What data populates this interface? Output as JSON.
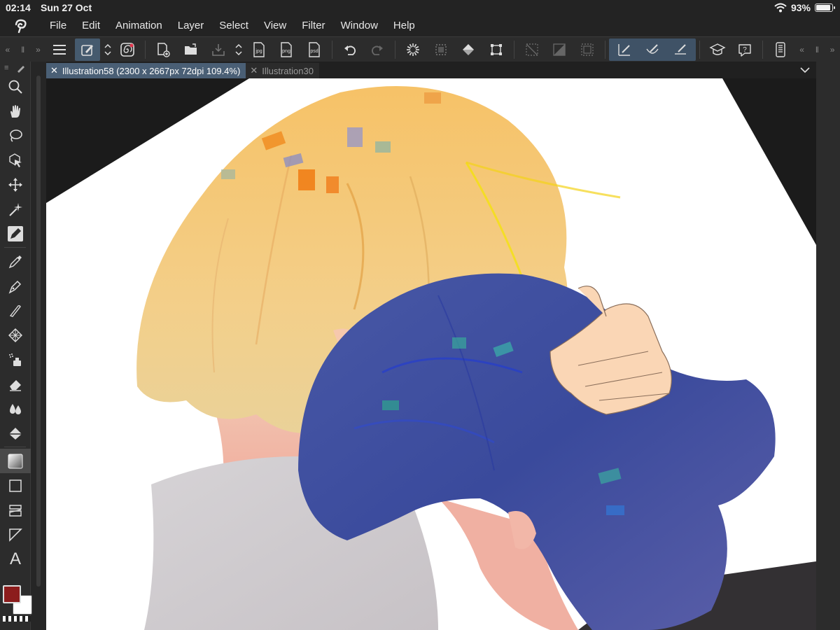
{
  "status": {
    "time": "02:14",
    "date": "Sun 27 Oct",
    "battery": "93%",
    "battery_level": 0.93
  },
  "menu": {
    "items": [
      "File",
      "Edit",
      "Animation",
      "Layer",
      "Select",
      "View",
      "Filter",
      "Window",
      "Help"
    ]
  },
  "command_bar": {
    "icons": [
      "menu-icon",
      "edit-brush-icon",
      "chevron-updown-icon",
      "spiral-icon",
      "new-canvas-icon",
      "open-folder-icon",
      "save-icon",
      "chevron-updown-icon",
      "jpg-export-icon",
      "png-export-icon",
      "psd-export-icon",
      "undo-icon",
      "redo-icon",
      "loading-icon",
      "select-dotted-icon",
      "fill-bucket-icon",
      "transform-icon",
      "deselect-icon",
      "invert-icon",
      "select-border-icon",
      "snap-ruler-icon",
      "snap-curve-icon",
      "snap-line-icon",
      "learn-icon",
      "help-icon",
      "tablet-icon"
    ],
    "labels": {
      "jpg": "jpg",
      "png": "png",
      "psd": "psd"
    }
  },
  "tools": [
    "search-zoom-icon",
    "hand-icon",
    "lasso-icon",
    "select-object-icon",
    "move-icon",
    "magic-wand-icon",
    "pen-fill-icon",
    "eyedropper-icon",
    "pen-icon",
    "pencil-icon",
    "pattern-icon",
    "airbrush-icon",
    "eraser-icon",
    "blend-icon",
    "fill-icon",
    "gradient-icon",
    "rectangle-icon",
    "frame-icon",
    "ruler-icon",
    "text-icon"
  ],
  "text_tool_label": "A",
  "colors": {
    "main": "#8c1c1c",
    "sub": "#ffffff",
    "accent": "#4a5f75"
  },
  "tabs": [
    {
      "label": "Illustration58 (2300 x 2667px 72dpi 109.4%)",
      "active": true
    },
    {
      "label": "Illustration30",
      "active": false
    }
  ]
}
